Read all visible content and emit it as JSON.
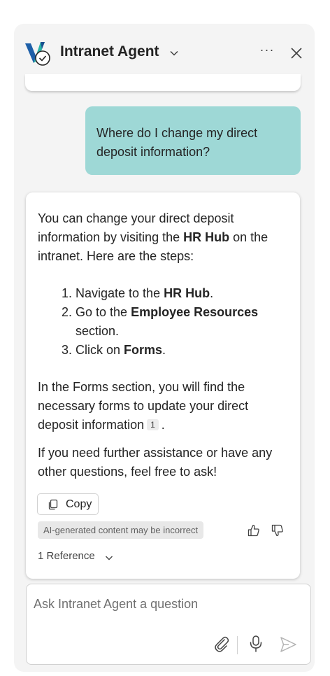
{
  "header": {
    "title": "Intranet Agent",
    "icons": [
      "agent-logo-icon",
      "chevron-down-icon",
      "more-options-icon",
      "close-icon"
    ],
    "more_label": "···"
  },
  "conversation": {
    "user_message": "Where do I change my direct deposit information?",
    "answer": {
      "intro_part1": "You can change your direct deposit information by visiting the ",
      "intro_bold": "HR Hub",
      "intro_part2": " on the intranet. Here are the steps:",
      "steps": [
        {
          "before": "Navigate to the ",
          "bold": "HR Hub",
          "after": "."
        },
        {
          "before": "Go to the ",
          "bold": "Employee Resources",
          "after": " section."
        },
        {
          "before": "Click on ",
          "bold": "Forms",
          "after": "."
        }
      ],
      "forms_text": "In the Forms section, you will find the necessary forms to update your direct deposit information",
      "citation": "1",
      "forms_end": ".",
      "closing": "If you need further assistance or have any other questions, feel free to ask!"
    },
    "copy_label": "Copy",
    "ai_disclaimer": "AI-generated content may be incorrect",
    "references_label": "1 Reference"
  },
  "composer": {
    "placeholder": "Ask Intranet Agent a question"
  },
  "colors": {
    "user_bubble": "#9ed8d6",
    "panel_bg": "#f4f4f4",
    "logo_blue": "#1d5fa8",
    "logo_teal": "#2bb3a8"
  }
}
